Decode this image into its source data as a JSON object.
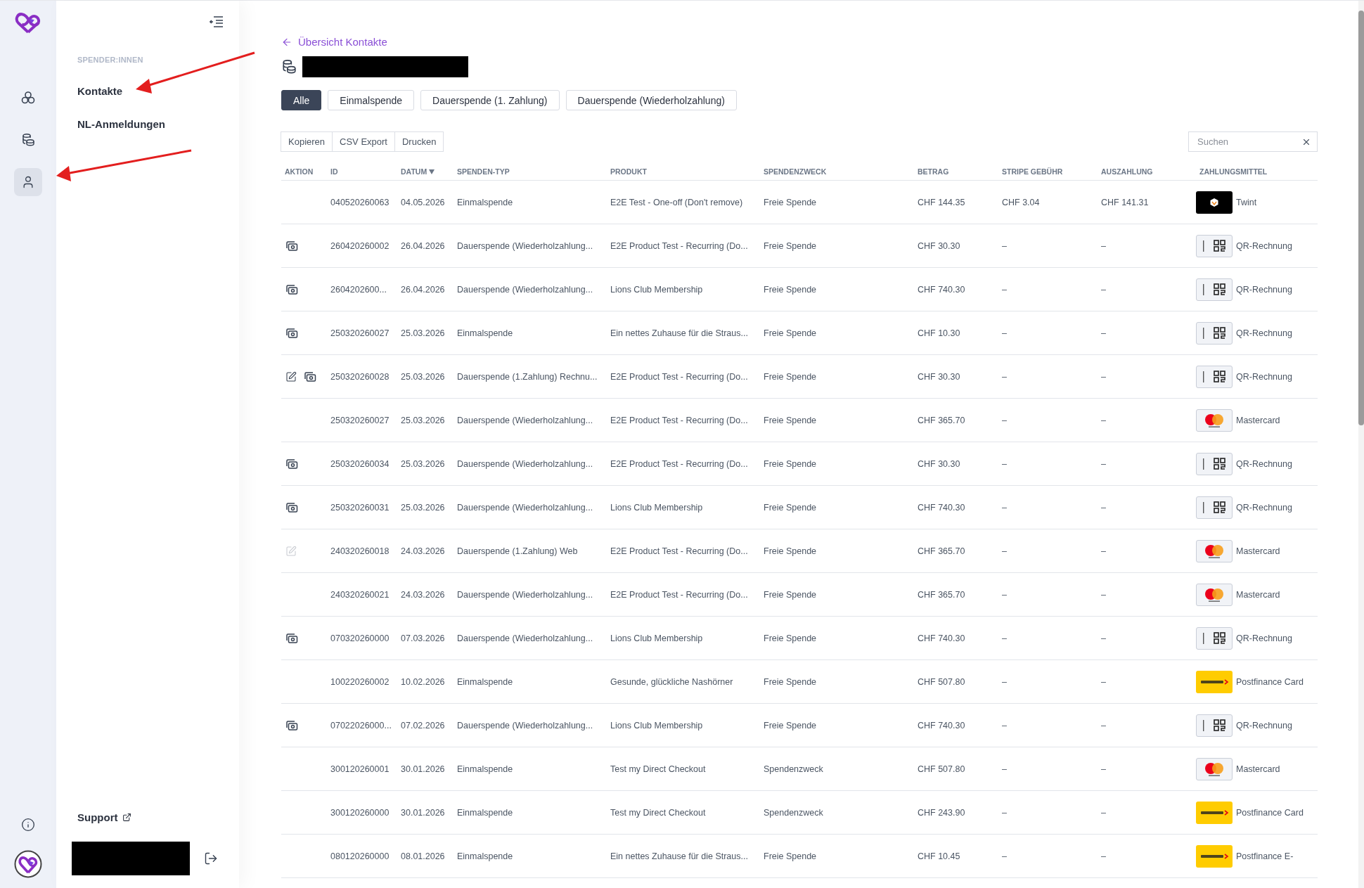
{
  "rail": [
    {
      "kind": "groups",
      "selected": false
    },
    {
      "kind": "coins",
      "selected": false
    },
    {
      "kind": "person",
      "selected": true
    }
  ],
  "nav": {
    "section": "SPENDER:INNEN",
    "items": [
      "Kontakte",
      "NL-Anmeldungen"
    ],
    "support": "Support"
  },
  "back_link": "Übersicht Kontakte",
  "filters": [
    {
      "label": "Alle",
      "selected": true
    },
    {
      "label": "Einmalspende",
      "selected": false
    },
    {
      "label": "Dauerspende (1. Zahlung)",
      "selected": false
    },
    {
      "label": "Dauerspende (Wiederholzahlung)",
      "selected": false
    }
  ],
  "export_buttons": [
    "Kopieren",
    "CSV Export",
    "Drucken"
  ],
  "search": {
    "placeholder": "Suchen"
  },
  "table": {
    "columns": [
      {
        "label": "AKTION",
        "sorted": false
      },
      {
        "label": "ID",
        "sorted": false
      },
      {
        "label": "DATUM",
        "sorted": true
      },
      {
        "label": "SPENDEN-TYP",
        "sorted": false
      },
      {
        "label": "PRODUKT",
        "sorted": false
      },
      {
        "label": "SPENDENZWECK",
        "sorted": false
      },
      {
        "label": "BETRAG",
        "sorted": false
      },
      {
        "label": "STRIPE GEBÜHR",
        "sorted": false
      },
      {
        "label": "AUSZAHLUNG",
        "sorted": false
      },
      {
        "label": "ZAHLUNGSMITTEL",
        "sorted": false
      }
    ],
    "rows": [
      {
        "actions": [],
        "payment": {
          "kind": "twint"
        },
        "cells": [
          "",
          "040520260063",
          "04.05.2026",
          "Einmalspende",
          "E2E Test - One-off (Don't remove)",
          "Freie Spende",
          "CHF 144.35",
          "CHF 3.04",
          "CHF 141.31",
          "Twint"
        ]
      },
      {
        "actions": [
          {
            "kind": "banknotes",
            "disabled": false
          }
        ],
        "payment": {
          "kind": "qr"
        },
        "cells": [
          "",
          "260420260002",
          "26.04.2026",
          "Dauerspende (Wiederholzahlung...",
          "E2E Product Test - Recurring (Do...",
          "Freie Spende",
          "CHF 30.30",
          "–",
          "–",
          "QR-Rechnung"
        ]
      },
      {
        "actions": [
          {
            "kind": "banknotes",
            "disabled": false
          }
        ],
        "payment": {
          "kind": "qr"
        },
        "cells": [
          "",
          "2604202600...",
          "26.04.2026",
          "Dauerspende (Wiederholzahlung...",
          "Lions Club Membership",
          "Freie Spende",
          "CHF 740.30",
          "–",
          "–",
          "QR-Rechnung"
        ]
      },
      {
        "actions": [
          {
            "kind": "banknotes",
            "disabled": false
          }
        ],
        "payment": {
          "kind": "qr"
        },
        "cells": [
          "",
          "250320260027",
          "25.03.2026",
          "Einmalspende",
          "Ein nettes Zuhause für die Straus...",
          "Freie Spende",
          "CHF 10.30",
          "–",
          "–",
          "QR-Rechnung"
        ]
      },
      {
        "actions": [
          {
            "kind": "edit",
            "disabled": false
          },
          {
            "kind": "banknotes",
            "disabled": false
          }
        ],
        "payment": {
          "kind": "qr"
        },
        "cells": [
          "",
          "250320260028",
          "25.03.2026",
          "Dauerspende (1.Zahlung) Rechnu...",
          "E2E Product Test - Recurring (Do...",
          "Freie Spende",
          "CHF 30.30",
          "–",
          "–",
          "QR-Rechnung"
        ]
      },
      {
        "actions": [],
        "payment": {
          "kind": "mastercard"
        },
        "cells": [
          "",
          "250320260027",
          "25.03.2026",
          "Dauerspende (Wiederholzahlung...",
          "E2E Product Test - Recurring (Do...",
          "Freie Spende",
          "CHF 365.70",
          "–",
          "–",
          "Mastercard"
        ]
      },
      {
        "actions": [
          {
            "kind": "banknotes",
            "disabled": false
          }
        ],
        "payment": {
          "kind": "qr"
        },
        "cells": [
          "",
          "250320260034",
          "25.03.2026",
          "Dauerspende (Wiederholzahlung...",
          "E2E Product Test - Recurring (Do...",
          "Freie Spende",
          "CHF 30.30",
          "–",
          "–",
          "QR-Rechnung"
        ]
      },
      {
        "actions": [
          {
            "kind": "banknotes",
            "disabled": false
          }
        ],
        "payment": {
          "kind": "qr"
        },
        "cells": [
          "",
          "250320260031",
          "25.03.2026",
          "Dauerspende (Wiederholzahlung...",
          "Lions Club Membership",
          "Freie Spende",
          "CHF 740.30",
          "–",
          "–",
          "QR-Rechnung"
        ]
      },
      {
        "actions": [
          {
            "kind": "edit",
            "disabled": true
          }
        ],
        "payment": {
          "kind": "mastercard"
        },
        "cells": [
          "",
          "240320260018",
          "24.03.2026",
          "Dauerspende (1.Zahlung) Web",
          "E2E Product Test - Recurring (Do...",
          "Freie Spende",
          "CHF 365.70",
          "–",
          "–",
          "Mastercard"
        ]
      },
      {
        "actions": [],
        "payment": {
          "kind": "mastercard"
        },
        "cells": [
          "",
          "240320260021",
          "24.03.2026",
          "Dauerspende (Wiederholzahlung...",
          "E2E Product Test - Recurring (Do...",
          "Freie Spende",
          "CHF 365.70",
          "–",
          "–",
          "Mastercard"
        ]
      },
      {
        "actions": [
          {
            "kind": "banknotes",
            "disabled": false
          }
        ],
        "payment": {
          "kind": "qr"
        },
        "cells": [
          "",
          "070320260000",
          "07.03.2026",
          "Dauerspende (Wiederholzahlung...",
          "Lions Club Membership",
          "Freie Spende",
          "CHF 740.30",
          "–",
          "–",
          "QR-Rechnung"
        ]
      },
      {
        "actions": [],
        "payment": {
          "kind": "postfinance"
        },
        "cells": [
          "",
          "100220260002",
          "10.02.2026",
          "Einmalspende",
          "Gesunde, glückliche Nashörner",
          "Freie Spende",
          "CHF 507.80",
          "–",
          "–",
          "Postfinance Card"
        ]
      },
      {
        "actions": [
          {
            "kind": "banknotes",
            "disabled": false
          }
        ],
        "payment": {
          "kind": "qr"
        },
        "cells": [
          "",
          "07022026000...",
          "07.02.2026",
          "Dauerspende (Wiederholzahlung...",
          "Lions Club Membership",
          "Freie Spende",
          "CHF 740.30",
          "–",
          "–",
          "QR-Rechnung"
        ]
      },
      {
        "actions": [],
        "payment": {
          "kind": "mastercard"
        },
        "cells": [
          "",
          "300120260001",
          "30.01.2026",
          "Einmalspende",
          "Test my Direct Checkout",
          "Spendenzweck",
          "CHF 507.80",
          "–",
          "–",
          "Mastercard"
        ]
      },
      {
        "actions": [],
        "payment": {
          "kind": "postfinance"
        },
        "cells": [
          "",
          "300120260000",
          "30.01.2026",
          "Einmalspende",
          "Test my Direct Checkout",
          "Spendenzweck",
          "CHF 243.90",
          "–",
          "–",
          "Postfinance Card"
        ]
      },
      {
        "actions": [],
        "payment": {
          "kind": "postfinance"
        },
        "cells": [
          "",
          "080120260000",
          "08.01.2026",
          "Einmalspende",
          "Ein nettes Zuhause für die Straus...",
          "Freie Spende",
          "CHF 10.45",
          "–",
          "–",
          "Postfinance E-"
        ]
      }
    ]
  }
}
